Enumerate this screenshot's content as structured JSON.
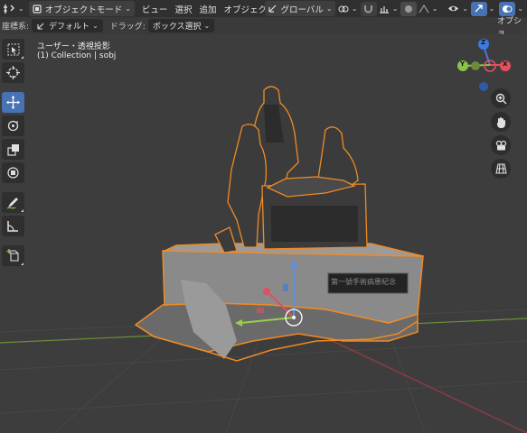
{
  "header": {
    "mode_label": "オブジェクトモード",
    "menu_view": "ビュー",
    "menu_select": "選択",
    "menu_add": "追加",
    "menu_object": "オブジェクト",
    "transform_orientation": "グローバル"
  },
  "tool_settings": {
    "coord_label": "座標系:",
    "coord_value": "デフォルト",
    "drag_label": "ドラッグ:",
    "drag_value": "ボックス選択",
    "options_label": "オプショ"
  },
  "viewport": {
    "view_name": "ユーザー・透視投影",
    "collection": "(1) Collection | sobj",
    "plaque_text": "第一號手術病患紀念"
  },
  "gizmo": {
    "axis_x": "X",
    "axis_y": "Y",
    "axis_z": "Z"
  },
  "colors": {
    "accent": "#4772b3",
    "selection_outline": "#f08a24",
    "axis_x": "#e05060",
    "axis_y": "#8bc34a",
    "axis_z": "#3f7ae0"
  }
}
